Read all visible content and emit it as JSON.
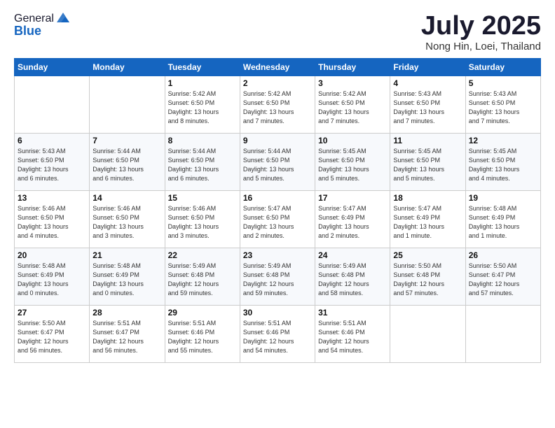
{
  "logo": {
    "general": "General",
    "blue": "Blue"
  },
  "header": {
    "month": "July 2025",
    "location": "Nong Hin, Loei, Thailand"
  },
  "weekdays": [
    "Sunday",
    "Monday",
    "Tuesday",
    "Wednesday",
    "Thursday",
    "Friday",
    "Saturday"
  ],
  "weeks": [
    [
      {
        "day": "",
        "info": ""
      },
      {
        "day": "",
        "info": ""
      },
      {
        "day": "1",
        "info": "Sunrise: 5:42 AM\nSunset: 6:50 PM\nDaylight: 13 hours\nand 8 minutes."
      },
      {
        "day": "2",
        "info": "Sunrise: 5:42 AM\nSunset: 6:50 PM\nDaylight: 13 hours\nand 7 minutes."
      },
      {
        "day": "3",
        "info": "Sunrise: 5:42 AM\nSunset: 6:50 PM\nDaylight: 13 hours\nand 7 minutes."
      },
      {
        "day": "4",
        "info": "Sunrise: 5:43 AM\nSunset: 6:50 PM\nDaylight: 13 hours\nand 7 minutes."
      },
      {
        "day": "5",
        "info": "Sunrise: 5:43 AM\nSunset: 6:50 PM\nDaylight: 13 hours\nand 7 minutes."
      }
    ],
    [
      {
        "day": "6",
        "info": "Sunrise: 5:43 AM\nSunset: 6:50 PM\nDaylight: 13 hours\nand 6 minutes."
      },
      {
        "day": "7",
        "info": "Sunrise: 5:44 AM\nSunset: 6:50 PM\nDaylight: 13 hours\nand 6 minutes."
      },
      {
        "day": "8",
        "info": "Sunrise: 5:44 AM\nSunset: 6:50 PM\nDaylight: 13 hours\nand 6 minutes."
      },
      {
        "day": "9",
        "info": "Sunrise: 5:44 AM\nSunset: 6:50 PM\nDaylight: 13 hours\nand 5 minutes."
      },
      {
        "day": "10",
        "info": "Sunrise: 5:45 AM\nSunset: 6:50 PM\nDaylight: 13 hours\nand 5 minutes."
      },
      {
        "day": "11",
        "info": "Sunrise: 5:45 AM\nSunset: 6:50 PM\nDaylight: 13 hours\nand 5 minutes."
      },
      {
        "day": "12",
        "info": "Sunrise: 5:45 AM\nSunset: 6:50 PM\nDaylight: 13 hours\nand 4 minutes."
      }
    ],
    [
      {
        "day": "13",
        "info": "Sunrise: 5:46 AM\nSunset: 6:50 PM\nDaylight: 13 hours\nand 4 minutes."
      },
      {
        "day": "14",
        "info": "Sunrise: 5:46 AM\nSunset: 6:50 PM\nDaylight: 13 hours\nand 3 minutes."
      },
      {
        "day": "15",
        "info": "Sunrise: 5:46 AM\nSunset: 6:50 PM\nDaylight: 13 hours\nand 3 minutes."
      },
      {
        "day": "16",
        "info": "Sunrise: 5:47 AM\nSunset: 6:50 PM\nDaylight: 13 hours\nand 2 minutes."
      },
      {
        "day": "17",
        "info": "Sunrise: 5:47 AM\nSunset: 6:49 PM\nDaylight: 13 hours\nand 2 minutes."
      },
      {
        "day": "18",
        "info": "Sunrise: 5:47 AM\nSunset: 6:49 PM\nDaylight: 13 hours\nand 1 minute."
      },
      {
        "day": "19",
        "info": "Sunrise: 5:48 AM\nSunset: 6:49 PM\nDaylight: 13 hours\nand 1 minute."
      }
    ],
    [
      {
        "day": "20",
        "info": "Sunrise: 5:48 AM\nSunset: 6:49 PM\nDaylight: 13 hours\nand 0 minutes."
      },
      {
        "day": "21",
        "info": "Sunrise: 5:48 AM\nSunset: 6:49 PM\nDaylight: 13 hours\nand 0 minutes."
      },
      {
        "day": "22",
        "info": "Sunrise: 5:49 AM\nSunset: 6:48 PM\nDaylight: 12 hours\nand 59 minutes."
      },
      {
        "day": "23",
        "info": "Sunrise: 5:49 AM\nSunset: 6:48 PM\nDaylight: 12 hours\nand 59 minutes."
      },
      {
        "day": "24",
        "info": "Sunrise: 5:49 AM\nSunset: 6:48 PM\nDaylight: 12 hours\nand 58 minutes."
      },
      {
        "day": "25",
        "info": "Sunrise: 5:50 AM\nSunset: 6:48 PM\nDaylight: 12 hours\nand 57 minutes."
      },
      {
        "day": "26",
        "info": "Sunrise: 5:50 AM\nSunset: 6:47 PM\nDaylight: 12 hours\nand 57 minutes."
      }
    ],
    [
      {
        "day": "27",
        "info": "Sunrise: 5:50 AM\nSunset: 6:47 PM\nDaylight: 12 hours\nand 56 minutes."
      },
      {
        "day": "28",
        "info": "Sunrise: 5:51 AM\nSunset: 6:47 PM\nDaylight: 12 hours\nand 56 minutes."
      },
      {
        "day": "29",
        "info": "Sunrise: 5:51 AM\nSunset: 6:46 PM\nDaylight: 12 hours\nand 55 minutes."
      },
      {
        "day": "30",
        "info": "Sunrise: 5:51 AM\nSunset: 6:46 PM\nDaylight: 12 hours\nand 54 minutes."
      },
      {
        "day": "31",
        "info": "Sunrise: 5:51 AM\nSunset: 6:46 PM\nDaylight: 12 hours\nand 54 minutes."
      },
      {
        "day": "",
        "info": ""
      },
      {
        "day": "",
        "info": ""
      }
    ]
  ]
}
